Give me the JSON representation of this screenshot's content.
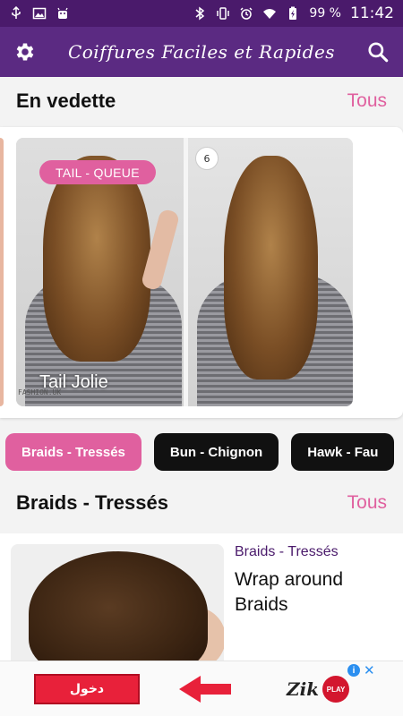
{
  "status_bar": {
    "battery": "99 %",
    "time": "11:42",
    "icons_left": [
      "usb-icon",
      "image-icon",
      "android-icon"
    ],
    "icons_right": [
      "bluetooth-icon",
      "vibrate-icon",
      "alarm-icon",
      "wifi-icon",
      "battery-icon"
    ]
  },
  "app_bar": {
    "title": "Coiffures Faciles et Rapides",
    "left_icon": "gear-icon",
    "right_icon": "search-icon"
  },
  "featured": {
    "title": "En vedette",
    "link": "Tous",
    "card": {
      "tag": "TAIL - QUEUE",
      "title": "Tail Jolie",
      "step_badge": "6",
      "watermark": "FASHION.UK"
    }
  },
  "chips": [
    {
      "label": "Braids - Tressés",
      "active": true
    },
    {
      "label": "Bun - Chignon",
      "active": false
    },
    {
      "label": "Hawk - Fau",
      "active": false
    }
  ],
  "braids_section": {
    "title": "Braids - Tressés",
    "link": "Tous",
    "item": {
      "category": "Braids - Tressés",
      "title": "Wrap around Braids"
    }
  },
  "ad": {
    "button_label": "دخول",
    "logo_text": "Zik",
    "logo_badge": "PLAY",
    "info": "i",
    "close": "✕"
  },
  "colors": {
    "primary": "#5b2a82",
    "status_bar": "#4a1a6b",
    "accent": "#e0609f",
    "chip_dark": "#111111"
  }
}
